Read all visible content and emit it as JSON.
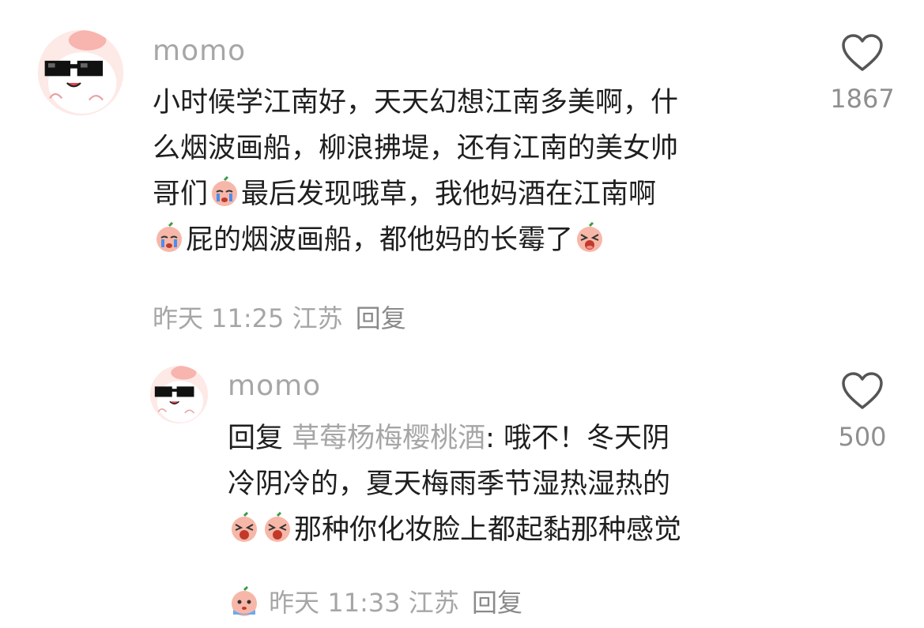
{
  "comments": [
    {
      "username": "momo",
      "lines": [
        [
          "小时候学江南好，天天幻想江南多美啊，什"
        ],
        [
          "么烟波画船，柳浪拂堤，还有江南的美女帅"
        ],
        [
          "哥们",
          "最后发现哦草，我他妈酒在江南啊"
        ],
        [
          "",
          "屁的烟波画船，都他妈的长霉了",
          ""
        ]
      ],
      "meta": {
        "time": "昨天 11:25",
        "location": "江苏",
        "reply": "回复"
      },
      "likes": "1867"
    },
    {
      "username": "momo",
      "reply_prefix": "回复",
      "mention": "草莓杨梅樱桃酒",
      "lines": [
        [
          "哦不！冬天阴"
        ],
        [
          "冷阴冷的，夏天梅雨季节湿热湿热的"
        ],
        [
          "",
          "",
          "那种你化妆脸上都起黏那种感觉"
        ]
      ],
      "meta": {
        "time": "昨天 11:33",
        "location": "江苏",
        "reply": "回复"
      },
      "likes": "500"
    }
  ],
  "icons": {
    "like": "heart-outline-icon",
    "avatar": "pink-blob-with-sunglasses",
    "emoji_crying": "crying-peach-emoji",
    "emoji_scream": "screaming-peach-emoji",
    "emoji_sad": "sad-peach-emoji"
  },
  "colors": {
    "muted": "#a6a6a6",
    "text": "#1f1f1f",
    "avatar_bg": "#fde9e6"
  }
}
